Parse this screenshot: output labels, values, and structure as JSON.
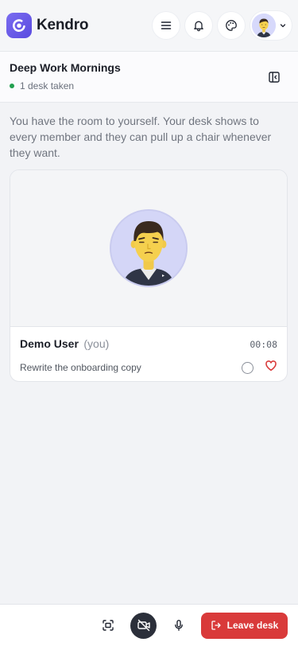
{
  "app": {
    "brand_name": "Kendro",
    "accent_color": "#6b5cf0"
  },
  "header": {
    "icons": [
      "menu-icon",
      "bell-icon",
      "palette-icon",
      "avatar",
      "chevron-down-icon"
    ]
  },
  "room": {
    "title": "Deep Work Mornings",
    "status": "1 desk taken",
    "status_color": "#22a04f"
  },
  "info_text": "You have the room to yourself. Your desk shows to every member and they can pull up a chair whenever they want.",
  "desk": {
    "user_name": "Demo User",
    "you_label": "(you)",
    "timer": "00:08",
    "task": "Rewrite the onboarding copy",
    "heart_color": "#d93a3a"
  },
  "bottom_bar": {
    "leave_label": "Leave desk",
    "leave_color": "#d93a3a",
    "icons": [
      "screen-share-icon",
      "camera-off-icon",
      "microphone-icon",
      "logout-icon"
    ]
  }
}
